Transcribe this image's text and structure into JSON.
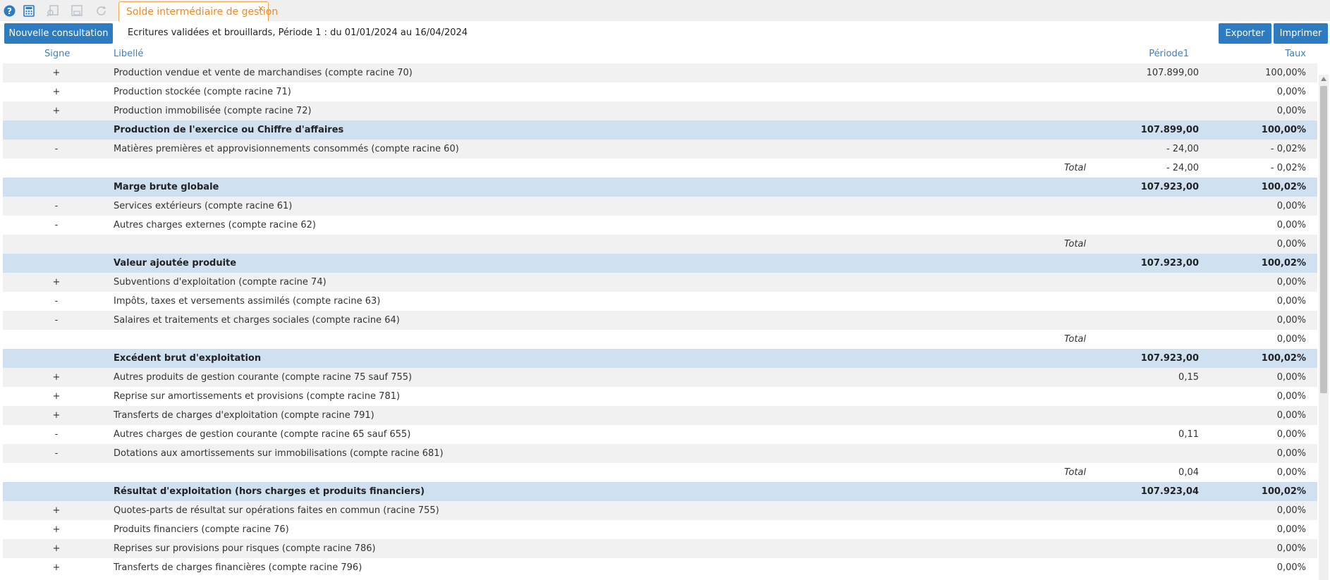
{
  "toolbar": {
    "icons": [
      "help-icon",
      "calculator-icon",
      "search-doc-icon",
      "save-icon",
      "refresh-icon"
    ],
    "tab_label": "Solde intermédiaire de gestion",
    "tab_close": "×"
  },
  "header": {
    "new_button": "Nouvelle consultation",
    "period_info": "Ecritures validées et brouillards, Période 1 : du 01/01/2024 au 16/04/2024",
    "export_button": "Exporter",
    "print_button": "Imprimer"
  },
  "columns": {
    "sign": "Signe",
    "label": "Libellé",
    "period": "Période1",
    "rate": "Taux"
  },
  "colors": {
    "accent": "#2d7cc1",
    "tab": "#ee8a24",
    "subtotal_bg": "#cfe1f1",
    "stripe": "#f1f1f1"
  },
  "rows": [
    {
      "type": "item",
      "sign": "+",
      "label": "Production vendue et vente de marchandises (compte racine 70)",
      "period": "107.899,00",
      "rate": "100,00%"
    },
    {
      "type": "item",
      "sign": "+",
      "label": "Production stockée (compte racine 71)",
      "period": "",
      "rate": "0,00%"
    },
    {
      "type": "item",
      "sign": "+",
      "label": "Production immobilisée (compte racine 72)",
      "period": "",
      "rate": "0,00%"
    },
    {
      "type": "subtotal",
      "sign": "",
      "label": "Production de l'exercice ou Chiffre d'affaires",
      "period": "107.899,00",
      "rate": "100,00%"
    },
    {
      "type": "item",
      "sign": "-",
      "label": "Matières premières et approvisionnements consommés (compte racine 60)",
      "period": "- 24,00",
      "rate": "- 0,02%"
    },
    {
      "type": "total",
      "sign": "",
      "label": "Total",
      "period": "- 24,00",
      "rate": "- 0,02%"
    },
    {
      "type": "subtotal",
      "sign": "",
      "label": "Marge brute globale",
      "period": "107.923,00",
      "rate": "100,02%"
    },
    {
      "type": "item",
      "sign": "-",
      "label": "Services extérieurs (compte racine 61)",
      "period": "",
      "rate": "0,00%"
    },
    {
      "type": "item",
      "sign": "-",
      "label": "Autres charges externes (compte racine 62)",
      "period": "",
      "rate": "0,00%"
    },
    {
      "type": "total",
      "sign": "",
      "label": "Total",
      "period": "",
      "rate": "0,00%"
    },
    {
      "type": "subtotal",
      "sign": "",
      "label": "Valeur ajoutée produite",
      "period": "107.923,00",
      "rate": "100,02%"
    },
    {
      "type": "item",
      "sign": "+",
      "label": "Subventions d'exploitation (compte racine 74)",
      "period": "",
      "rate": "0,00%"
    },
    {
      "type": "item",
      "sign": "-",
      "label": "Impôts, taxes et versements assimilés (compte racine 63)",
      "period": "",
      "rate": "0,00%"
    },
    {
      "type": "item",
      "sign": "-",
      "label": "Salaires et traitements et charges sociales (compte racine 64)",
      "period": "",
      "rate": "0,00%"
    },
    {
      "type": "total",
      "sign": "",
      "label": "Total",
      "period": "",
      "rate": "0,00%"
    },
    {
      "type": "subtotal",
      "sign": "",
      "label": "Excédent brut d'exploitation",
      "period": "107.923,00",
      "rate": "100,02%"
    },
    {
      "type": "item",
      "sign": "+",
      "label": "Autres produits de gestion courante (compte racine 75 sauf 755)",
      "period": "0,15",
      "rate": "0,00%"
    },
    {
      "type": "item",
      "sign": "+",
      "label": "Reprise sur amortissements et provisions (compte racine 781)",
      "period": "",
      "rate": "0,00%"
    },
    {
      "type": "item",
      "sign": "+",
      "label": "Transferts de charges d'exploitation (compte racine 791)",
      "period": "",
      "rate": "0,00%"
    },
    {
      "type": "item",
      "sign": "-",
      "label": "Autres charges de gestion courante (compte racine 65 sauf 655)",
      "period": "0,11",
      "rate": "0,00%"
    },
    {
      "type": "item",
      "sign": "-",
      "label": "Dotations aux amortissements sur immobilisations (compte racine 681)",
      "period": "",
      "rate": "0,00%"
    },
    {
      "type": "total",
      "sign": "",
      "label": "Total",
      "period": "0,04",
      "rate": "0,00%"
    },
    {
      "type": "subtotal",
      "sign": "",
      "label": "Résultat d'exploitation (hors charges et produits financiers)",
      "period": "107.923,04",
      "rate": "100,02%"
    },
    {
      "type": "item",
      "sign": "+",
      "label": "Quotes-parts de résultat sur opérations faites en commun (racine 755)",
      "period": "",
      "rate": "0,00%"
    },
    {
      "type": "item",
      "sign": "+",
      "label": "Produits financiers (compte racine 76)",
      "period": "",
      "rate": "0,00%"
    },
    {
      "type": "item",
      "sign": "+",
      "label": "Reprises sur provisions pour risques (compte racine 786)",
      "period": "",
      "rate": "0,00%"
    },
    {
      "type": "item",
      "sign": "+",
      "label": "Transferts de charges financières (compte racine 796)",
      "period": "",
      "rate": "0,00%"
    }
  ]
}
